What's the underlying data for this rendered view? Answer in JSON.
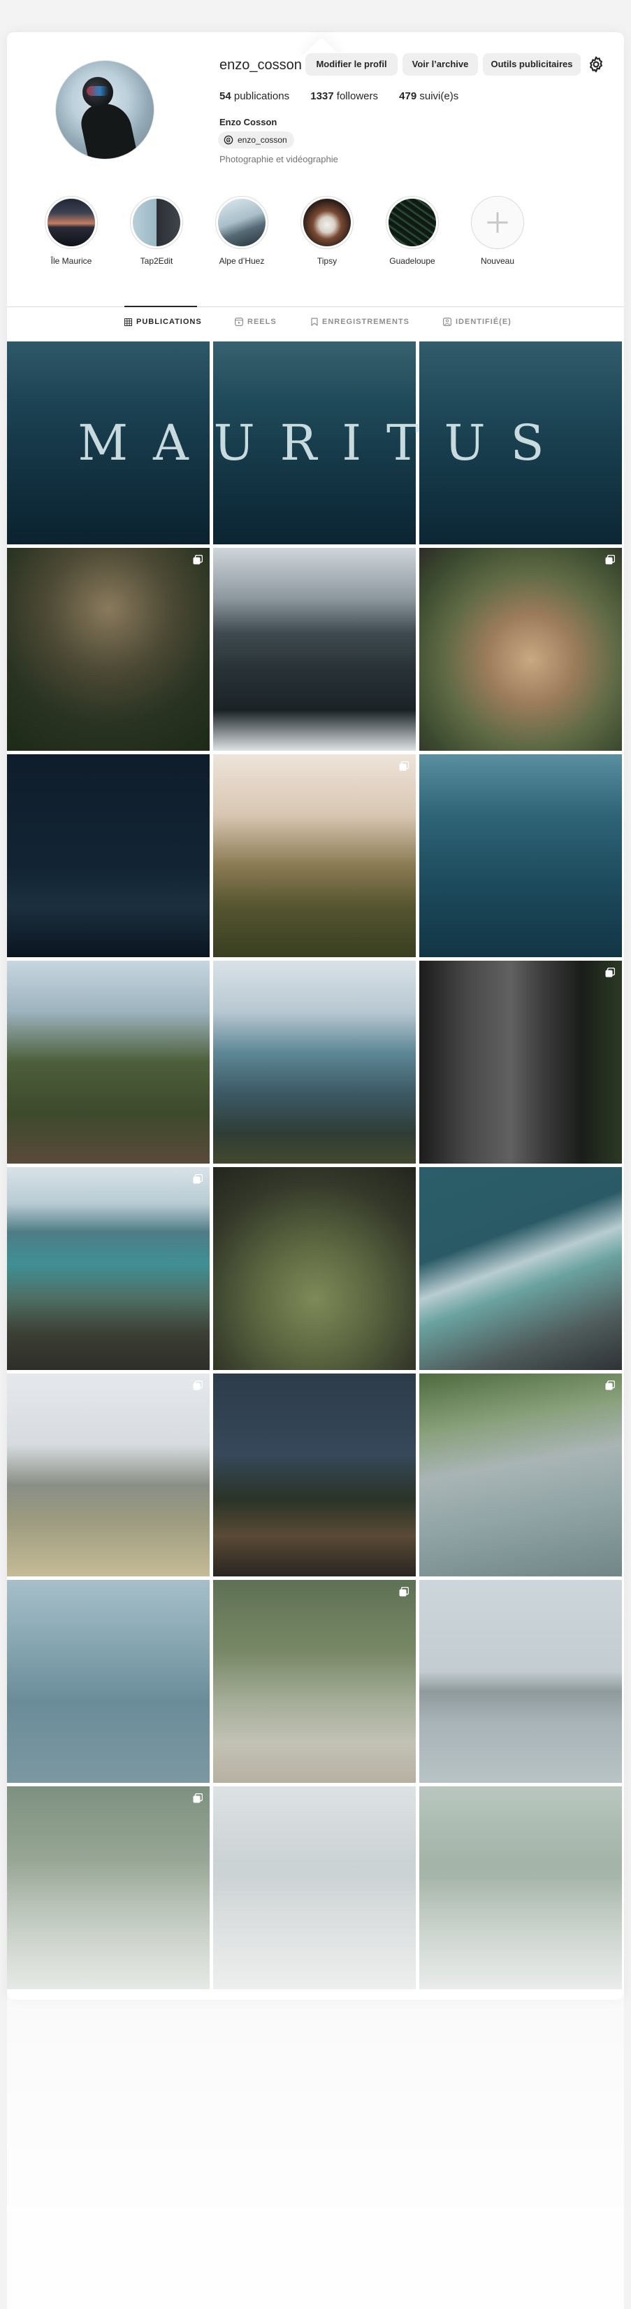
{
  "profile": {
    "username": "enzo_cosson",
    "buttons": {
      "edit": "Modifier le profil",
      "archive": "Voir l’archive",
      "ads": "Outils publicitaires"
    },
    "stats": {
      "posts_count": "54",
      "posts_label": "publications",
      "followers_count": "1337",
      "followers_label": "followers",
      "following_count": "479",
      "following_label": "suivi(e)s"
    },
    "full_name": "Enzo Cosson",
    "threads_handle": "enzo_cosson",
    "bio": "Photographie et vidéographie"
  },
  "highlights": [
    {
      "label": "Île Maurice",
      "icon": "sunset-coast-thumbnail"
    },
    {
      "label": "Tap2Edit",
      "icon": "dolphin-thumbnail"
    },
    {
      "label": "Alpe d’Huez",
      "icon": "snow-mountain-thumbnail"
    },
    {
      "label": "Tipsy",
      "icon": "dog-thumbnail"
    },
    {
      "label": "Guadeloupe",
      "icon": "palm-leaf-thumbnail"
    },
    {
      "label": "Nouveau",
      "icon": "plus-icon"
    }
  ],
  "tabs": [
    {
      "label": "PUBLICATIONS",
      "icon": "grid-icon",
      "active": true
    },
    {
      "label": "REELS",
      "icon": "reels-icon",
      "active": false
    },
    {
      "label": "ENREGISTREMENTS",
      "icon": "bookmark-icon",
      "active": false
    },
    {
      "label": "IDENTIFIÉ(E)",
      "icon": "tagged-person-icon",
      "active": false
    }
  ],
  "banner_text": "MAURITUS",
  "colors": {
    "accent_text": "#262626",
    "muted_text": "#737373",
    "button_bg": "#efefef",
    "divider": "#dbdbdb"
  },
  "posts": [
    {
      "subject": "underwater-dolphins",
      "carousel": false
    },
    {
      "subject": "underwater-dolphins",
      "carousel": false
    },
    {
      "subject": "underwater-dolphins",
      "carousel": false
    },
    {
      "subject": "banyan-tree",
      "carousel": true
    },
    {
      "subject": "boat-bow-lagoon",
      "carousel": false
    },
    {
      "subject": "macaque-monkey",
      "carousel": true
    },
    {
      "subject": "night-boats-stars",
      "carousel": false
    },
    {
      "subject": "green-hills",
      "carousel": true
    },
    {
      "subject": "dolphins-deep-blue",
      "carousel": false
    },
    {
      "subject": "palm-trees-fence",
      "carousel": false
    },
    {
      "subject": "old-bus",
      "carousel": false
    },
    {
      "subject": "green-gecko",
      "carousel": true
    },
    {
      "subject": "lagoon-aerial",
      "carousel": true
    },
    {
      "subject": "fern-closeup",
      "carousel": false
    },
    {
      "subject": "waves-cliff",
      "carousel": false
    },
    {
      "subject": "colonial-house",
      "carousel": true
    },
    {
      "subject": "tree-night-lights",
      "carousel": false
    },
    {
      "subject": "palm-pool",
      "carousel": true
    },
    {
      "subject": "underwater-dolphins-light",
      "carousel": false
    },
    {
      "subject": "mansion-forest",
      "carousel": true
    },
    {
      "subject": "le-morne-mountain",
      "carousel": false
    },
    {
      "subject": "jungle-faded",
      "carousel": true
    },
    {
      "subject": "misty-lake-faded",
      "carousel": false
    },
    {
      "subject": "palms-faded",
      "carousel": false
    }
  ]
}
